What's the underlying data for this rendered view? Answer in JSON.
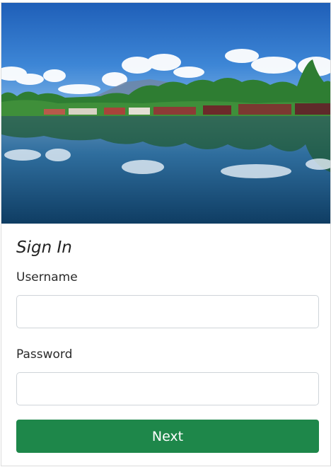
{
  "form": {
    "title": "Sign In",
    "username_label": "Username",
    "username_value": "",
    "password_label": "Password",
    "password_value": "",
    "next_label": "Next"
  },
  "hero": {
    "image_name": "lake-houseboats-photo"
  },
  "colors": {
    "button": "#1e874a",
    "field_border": "#cfd4d9"
  }
}
